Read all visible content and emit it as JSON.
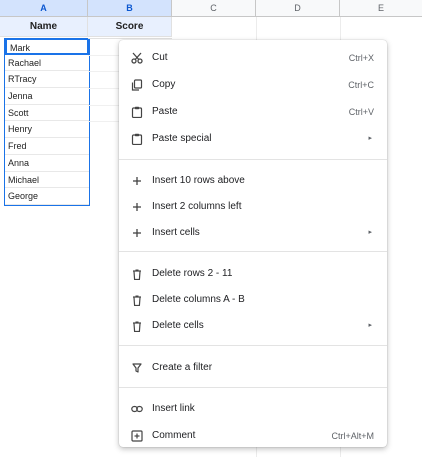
{
  "columns": [
    "A",
    "B",
    "C",
    "D",
    "E"
  ],
  "sheet": {
    "headers": [
      "Name",
      "Score"
    ],
    "names": [
      "Mark",
      "Rachael",
      "RTracy",
      "Jenna",
      "Scott",
      "Henry",
      "Fred",
      "Anna",
      "Michael",
      "George"
    ],
    "selection_color": "#1a73e8"
  },
  "menu": {
    "cut": {
      "label": "Cut",
      "shortcut": "Ctrl+X",
      "icon": "scissors-icon"
    },
    "copy": {
      "label": "Copy",
      "shortcut": "Ctrl+C",
      "icon": "copy-icon"
    },
    "paste": {
      "label": "Paste",
      "shortcut": "Ctrl+V",
      "icon": "clipboard-icon"
    },
    "paste_special": {
      "label": "Paste special",
      "icon": "clipboard-icon"
    },
    "insert_rows": {
      "label": "Insert 10 rows above",
      "icon": "plus-icon"
    },
    "insert_cols": {
      "label": "Insert 2 columns left",
      "icon": "plus-icon"
    },
    "insert_cells": {
      "label": "Insert cells",
      "icon": "plus-icon"
    },
    "delete_rows": {
      "label": "Delete rows 2 - 11",
      "icon": "trash-icon"
    },
    "delete_cols": {
      "label": "Delete columns A - B",
      "icon": "trash-icon"
    },
    "delete_cells": {
      "label": "Delete cells",
      "icon": "trash-icon"
    },
    "create_filter": {
      "label": "Create a filter",
      "icon": "filter-icon"
    },
    "insert_link": {
      "label": "Insert link",
      "icon": "link-icon"
    },
    "comment": {
      "label": "Comment",
      "shortcut": "Ctrl+Alt+M",
      "icon": "comment-icon"
    },
    "submenu_arrow": "▸"
  }
}
